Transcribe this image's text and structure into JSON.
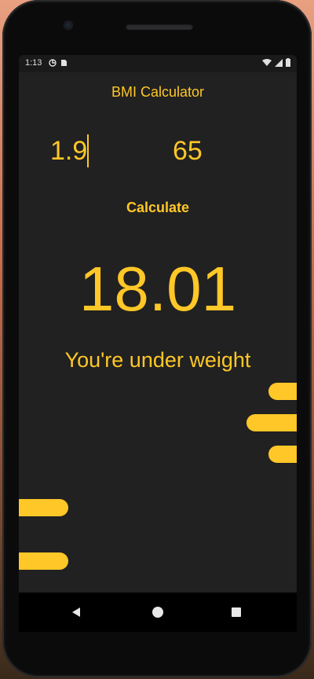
{
  "status_bar": {
    "time": "1:13",
    "icons": [
      "sync-icon",
      "sd-card-icon",
      "wifi-icon",
      "signal-icon",
      "battery-icon"
    ]
  },
  "app": {
    "title": "BMI Calculator"
  },
  "inputs": {
    "height_value": "1.9",
    "weight_value": "65"
  },
  "actions": {
    "calculate_label": "Calculate"
  },
  "result": {
    "bmi": "18.01",
    "message": "You're under weight"
  },
  "colors": {
    "accent": "#ffc727",
    "background": "#212121",
    "phone_frame": "#0b0b0c"
  },
  "navigation": {
    "buttons": [
      "back-icon",
      "home-icon",
      "recents-icon"
    ]
  }
}
